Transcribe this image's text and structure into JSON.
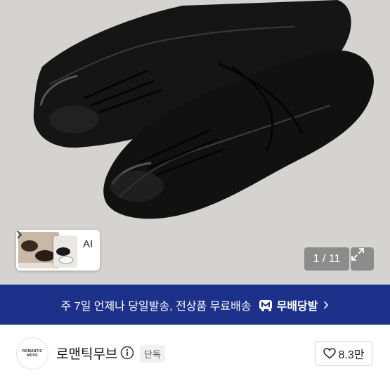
{
  "product_image": {
    "counter": "1 / 11",
    "ai_label": "AI"
  },
  "banner": {
    "text": "주 7일 언제나 당일발송, 전상품 무료배송",
    "brand": "무배당발"
  },
  "seller": {
    "avatar_line1": "ROMANTIC",
    "avatar_line2": "MOVE",
    "name": "로맨틱무브",
    "badge": "단독",
    "likes": "8.3만"
  },
  "colors": {
    "banner_bg": "#1d318a",
    "photo_bg": "#d9d8d4"
  }
}
